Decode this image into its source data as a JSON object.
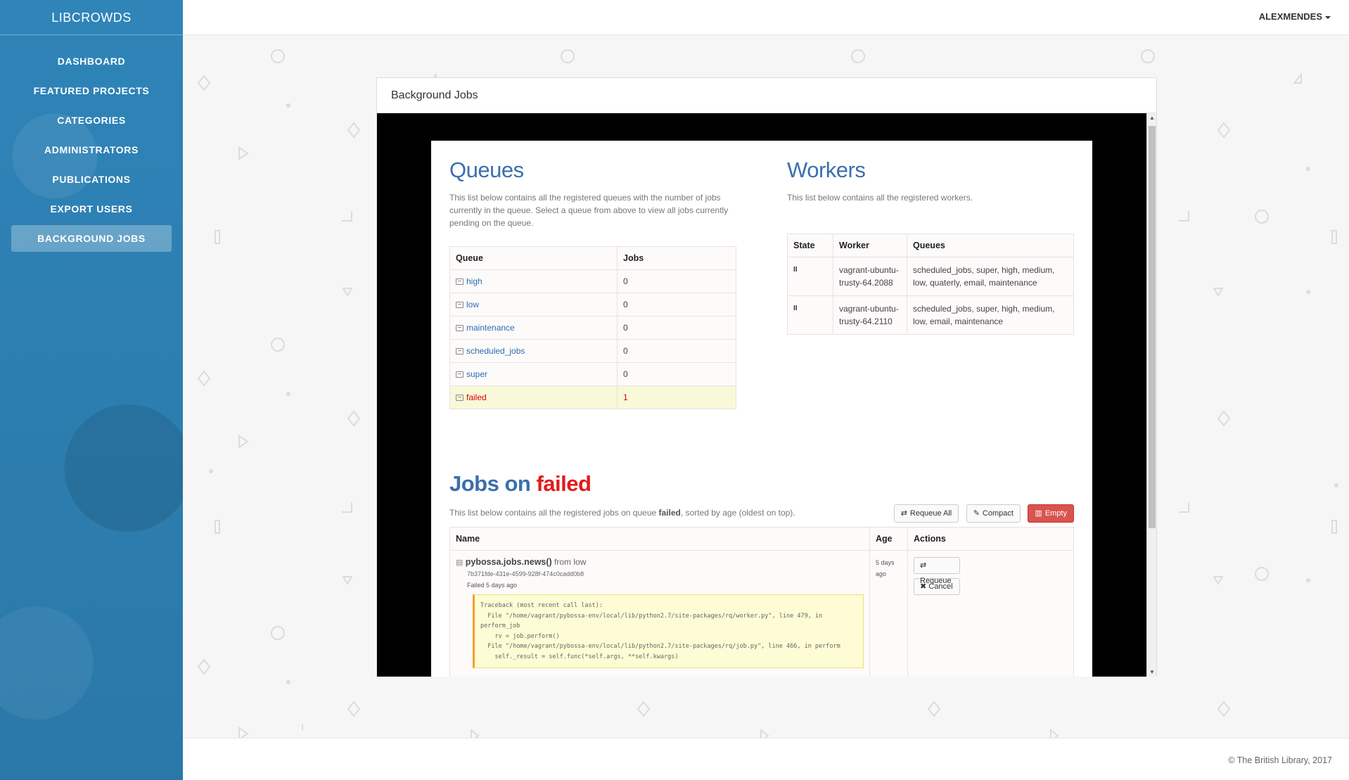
{
  "app": {
    "brand": "LIBCROWDS"
  },
  "sidebar": {
    "items": [
      {
        "label": "DASHBOARD"
      },
      {
        "label": "FEATURED PROJECTS"
      },
      {
        "label": "CATEGORIES"
      },
      {
        "label": "ADMINISTRATORS"
      },
      {
        "label": "PUBLICATIONS"
      },
      {
        "label": "EXPORT USERS"
      },
      {
        "label": "BACKGROUND JOBS",
        "active": true
      }
    ]
  },
  "header": {
    "user": "ALEXMENDES"
  },
  "panel": {
    "title": "Background Jobs"
  },
  "queues": {
    "title": "Queues",
    "description": "This list below contains all the registered queues with the number of jobs currently in the queue. Select a queue from above to view all jobs currently pending on the queue.",
    "headers": [
      "Queue",
      "Jobs"
    ],
    "rows": [
      {
        "name": "high",
        "jobs": "0"
      },
      {
        "name": "low",
        "jobs": "0"
      },
      {
        "name": "maintenance",
        "jobs": "0"
      },
      {
        "name": "scheduled_jobs",
        "jobs": "0"
      },
      {
        "name": "super",
        "jobs": "0"
      },
      {
        "name": "failed",
        "jobs": "1",
        "highlight": true
      }
    ]
  },
  "workers": {
    "title": "Workers",
    "description": "This list below contains all the registered workers.",
    "headers": [
      "State",
      "Worker",
      "Queues"
    ],
    "rows": [
      {
        "state": "II",
        "worker": "vagrant-ubuntu-trusty-64.2088",
        "queues": "scheduled_jobs, super, high, medium, low, quaterly, email, maintenance"
      },
      {
        "state": "II",
        "worker": "vagrant-ubuntu-trusty-64.2110",
        "queues": "scheduled_jobs, super, high, medium, low, email, maintenance"
      }
    ]
  },
  "jobs": {
    "title_prefix": "Jobs on",
    "queue_name": "failed",
    "description_pre": "This list below contains all the registered jobs on queue",
    "description_queue": "failed",
    "description_post": ", sorted by age (oldest on top).",
    "buttons": {
      "requeue_all": "Requeue All",
      "compact": "Compact",
      "empty": "Empty"
    },
    "headers": [
      "Name",
      "Age",
      "Actions"
    ],
    "items": [
      {
        "name": "pybossa.jobs.news()",
        "from": "from low",
        "id": "7b371fde-431e-4599-928f-474c0cadd0b8",
        "failed": "Failed 5 days ago",
        "traceback": "Traceback (most recent call last):\n  File \"/home/vagrant/pybossa-env/local/lib/python2.7/site-packages/rq/worker.py\", line 479, in perform_job\n    rv = job.perform()\n  File \"/home/vagrant/pybossa-env/local/lib/python2.7/site-packages/rq/job.py\", line 466, in perform\n    self._result = self.func(*self.args, **self.kwargs)",
        "age": "5 days ago",
        "actions": {
          "requeue": "Requeue",
          "cancel": "Cancel"
        }
      }
    ]
  },
  "footer": {
    "copyright": "© The British Library, 2017"
  },
  "colors": {
    "sidebar": "#2d7fb0",
    "accent": "#3a6fae",
    "danger": "#d9534f",
    "failed_text": "#e21b1b"
  },
  "icons": {
    "queue": "inbox-icon",
    "worker_state": "pause-icon",
    "requeue": "retweet-icon",
    "compact": "wand-icon",
    "empty": "trash-icon",
    "cancel": "close-icon",
    "job": "file-icon"
  }
}
